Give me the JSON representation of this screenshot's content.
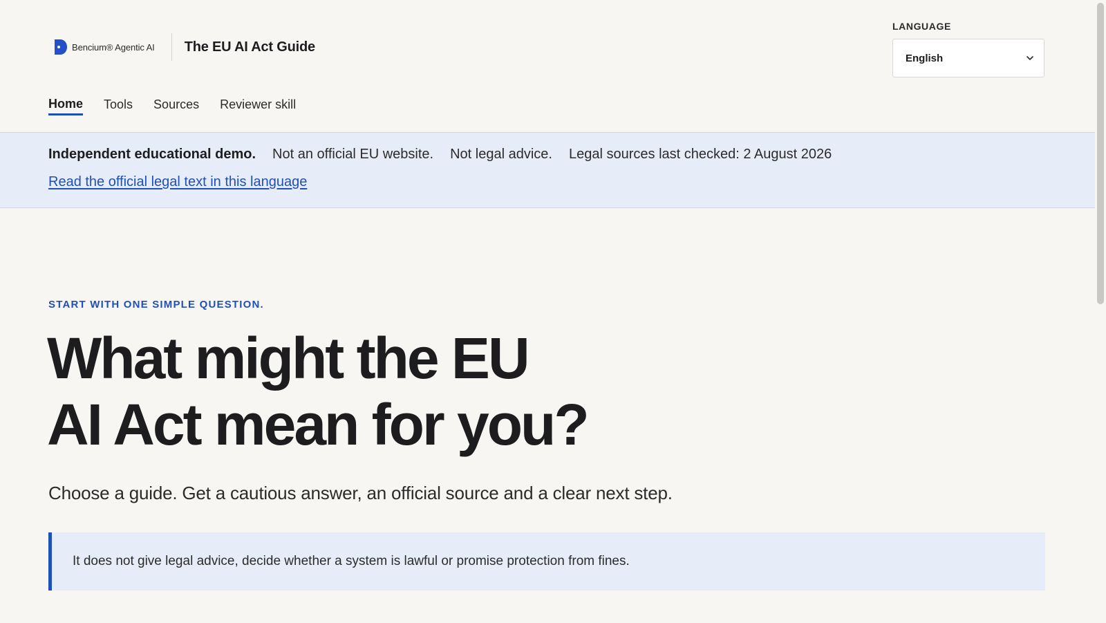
{
  "brand": {
    "name": "Bencium® Agentic AI",
    "logo_icon": "bencium-logo-icon",
    "accent": "#2350c8"
  },
  "site": {
    "title": "The EU AI Act Guide"
  },
  "language": {
    "label": "LANGUAGE",
    "selected": "English",
    "icon": "chevron-down-icon"
  },
  "nav": {
    "items": [
      {
        "label": "Home",
        "active": true
      },
      {
        "label": "Tools",
        "active": false
      },
      {
        "label": "Sources",
        "active": false
      },
      {
        "label": "Reviewer skill",
        "active": false
      }
    ]
  },
  "notice": {
    "strong": "Independent educational demo.",
    "items": [
      "Not an official EU website.",
      "Not legal advice.",
      "Legal sources last checked: 2 August 2026"
    ],
    "link": "Read the official legal text in this language",
    "background": "#e7edf8"
  },
  "hero": {
    "eyebrow": "START WITH ONE SIMPLE QUESTION.",
    "title_line1": "What might the EU",
    "title_line2": "AI Act mean for you?",
    "subtitle": "Choose a guide. Get a cautious answer, an official source and a clear next step.",
    "callout": "It does not give legal advice, decide whether a system is lawful or promise protection from fines."
  },
  "colors": {
    "accent_blue": "#1f4fb8",
    "page_background": "#f7f6f3",
    "text": "#1d1d1f"
  }
}
